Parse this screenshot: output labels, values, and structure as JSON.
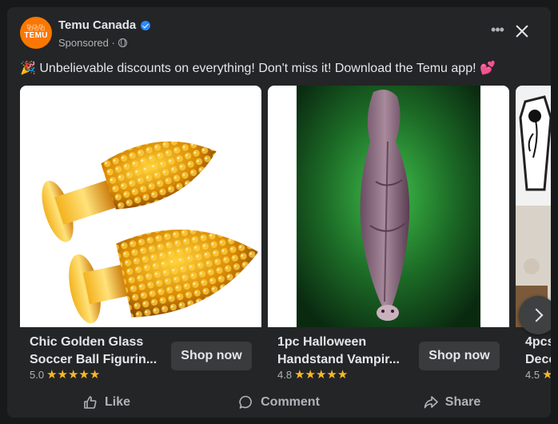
{
  "post": {
    "page_name": "Temu Canada",
    "avatar_glyphs": "⿻⿻⿻",
    "avatar_brand": "TEMU",
    "sponsored": "Sponsored ·",
    "more_label": "•••",
    "text": "🎉 Unbelievable discounts on everything! Don't miss it! Download the Temu app! 💕"
  },
  "products": [
    {
      "title_line1": "Chic Golden Glass",
      "title_line2": "Soccer Ball Figurin...",
      "rating": "5.0",
      "stars": "★★★★★",
      "button": "Shop now"
    },
    {
      "title_line1": "1pc Halloween",
      "title_line2": "Handstand Vampir...",
      "rating": "4.8",
      "stars": "★★★★★",
      "button": "Shop now"
    },
    {
      "title_line1": "4pcs",
      "title_line2": "Deco...",
      "rating": "4.5",
      "stars": "★",
      "button": ""
    }
  ],
  "actions": {
    "like": "Like",
    "comment": "Comment",
    "share": "Share"
  },
  "colors": {
    "brand": "#fb7701",
    "verified": "#2d88ff",
    "star": "#f7b928",
    "card": "#242526"
  },
  "icons": [
    "verified-badge-icon",
    "globe-icon",
    "more-icon",
    "close-icon",
    "chevron-right-icon",
    "thumbs-up-icon",
    "comment-icon",
    "share-icon"
  ]
}
